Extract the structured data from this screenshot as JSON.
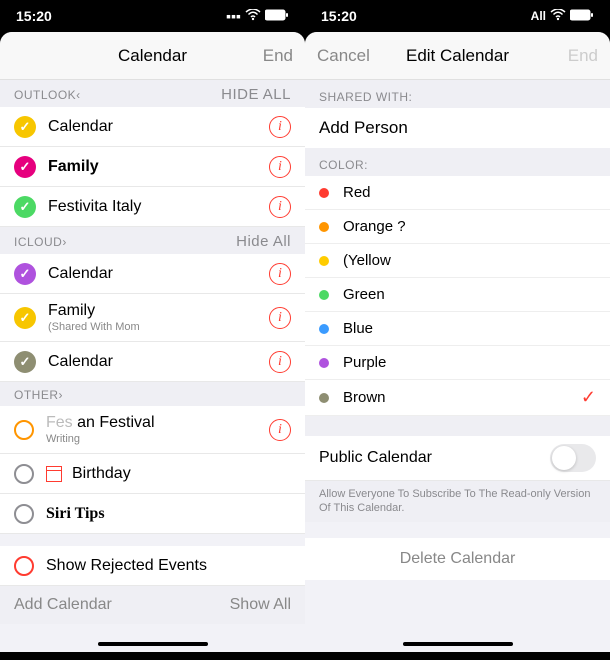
{
  "left": {
    "status": {
      "time": "15:20",
      "signal": "▪▪▪",
      "wifi": "on",
      "battery": "full"
    },
    "header": {
      "title": "Calendar",
      "right": "End"
    },
    "sections": {
      "outlook": {
        "label": "OUTLOOK‹",
        "hide": "HIDE ALL"
      },
      "icloud": {
        "label": "ICLOUD›",
        "hide": "Hide All"
      },
      "other": {
        "label": "OTHER›"
      }
    },
    "outlook_items": [
      {
        "label": "Calendar",
        "color": "#f7c600"
      },
      {
        "label": "Family",
        "color": "#e6007e",
        "bold": true
      },
      {
        "label": "Festivita Italy",
        "color": "#4cd964"
      }
    ],
    "icloud_items": [
      {
        "label": "Calendar",
        "color": "#af52de"
      },
      {
        "label": "Family",
        "sub": "(Shared With Mom",
        "color": "#f7c600"
      },
      {
        "label": "Calendar",
        "color": "#8e8e72"
      }
    ],
    "other_items": [
      {
        "label": "an Festival",
        "prefix": "Fes",
        "sub": "Writing",
        "color": "#ff9500"
      },
      {
        "label": "Birthday",
        "glyph": "calendar"
      },
      {
        "label": "Siri Tips",
        "serif": true
      }
    ],
    "show_rejected": "Show Rejected Events",
    "bottom": {
      "left": "Add Calendar",
      "right": "Show All"
    }
  },
  "right": {
    "status": {
      "time": "15:20",
      "label": "All"
    },
    "header": {
      "left": "Cancel",
      "title": "Edit Calendar",
      "right": "End"
    },
    "shared_with": "SHARED WITH:",
    "add_person": "Add Person",
    "color_label": "COLOR:",
    "colors": [
      {
        "name": "Red",
        "hex": "#ff3b30"
      },
      {
        "name": "Orange ?",
        "hex": "#ff9500"
      },
      {
        "name": "(Yellow",
        "hex": "#ffcc00"
      },
      {
        "name": "Green",
        "hex": "#4cd964"
      },
      {
        "name": "Blue",
        "hex": "#007aff"
      },
      {
        "name": "Purple",
        "hex": "#af52de"
      },
      {
        "name": "Brown",
        "hex": "#a2845e",
        "selected": true
      }
    ],
    "public": {
      "label": "Public Calendar",
      "help": "Allow Everyone To Subscribe To The Read-only Version Of This Calendar."
    },
    "delete": "Delete Calendar"
  }
}
